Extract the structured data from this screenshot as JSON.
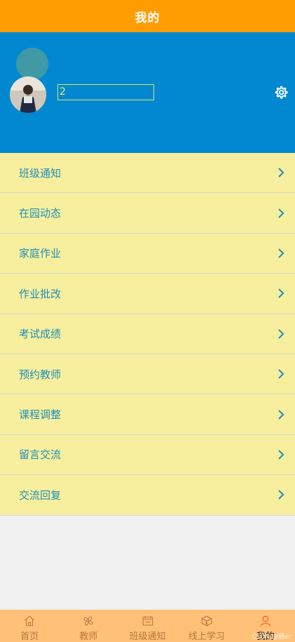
{
  "header": {
    "title": "我的"
  },
  "profile": {
    "username": "2",
    "settings_icon": "gear-icon"
  },
  "menu": {
    "items": [
      {
        "label": "班级通知"
      },
      {
        "label": "在园动态"
      },
      {
        "label": "家庭作业"
      },
      {
        "label": "作业批改"
      },
      {
        "label": "考试成绩"
      },
      {
        "label": "预约教师"
      },
      {
        "label": "课程调整"
      },
      {
        "label": "留言交流"
      },
      {
        "label": "交流回复"
      }
    ]
  },
  "tabbar": {
    "tabs": [
      {
        "label": "首页",
        "icon": "home-icon"
      },
      {
        "label": "教师",
        "icon": "teacher-icon"
      },
      {
        "label": "班级通知",
        "icon": "notice-icon"
      },
      {
        "label": "线上学习",
        "icon": "online-study-icon"
      },
      {
        "label": "我的",
        "icon": "user-icon"
      }
    ]
  },
  "watermark": "CSDN @顾er",
  "colors": {
    "header": "#ff9c00",
    "profile_bg": "#0288d1",
    "menu_bg": "#f7ef9e",
    "menu_text": "#1f8fb7",
    "tabbar_bg": "#ffc178"
  }
}
